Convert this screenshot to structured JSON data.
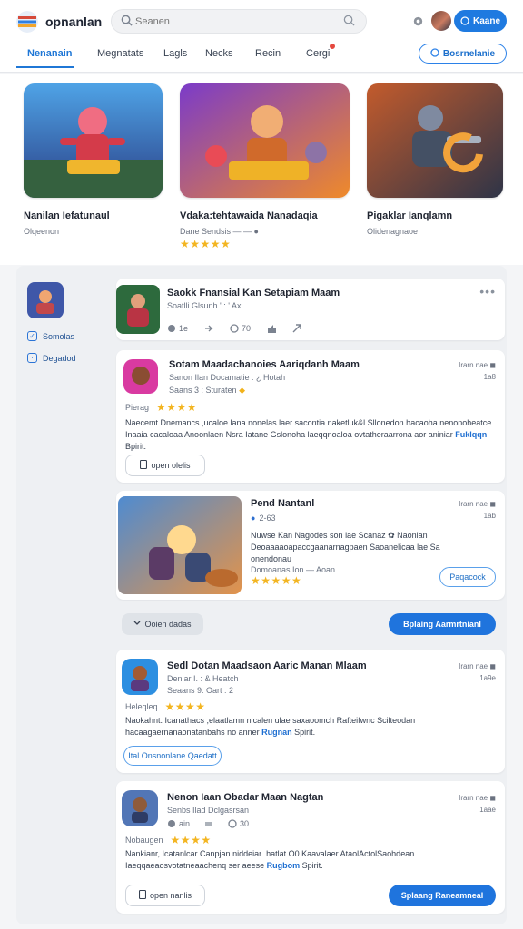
{
  "header": {
    "app_name": "opnanlan",
    "search_placeholder": "Seanen",
    "action_label": "Kaane",
    "filter_chip": "Bosrnelanie"
  },
  "tabs": [
    "Nenanain",
    "Megnatats",
    "Lagls",
    "Necks",
    "Recin",
    "Cergi"
  ],
  "featured": [
    {
      "title": "Nanilan Iefatunaul",
      "subtitle": "Olqeenon"
    },
    {
      "title": "Vdaka:tehtawaida Nanadaqia",
      "subtitle": "Dane Sendsis — — ●",
      "stars": "★★★★★"
    },
    {
      "title": "Pigaklar Ianqlamn",
      "subtitle": "Olidenagnaoe"
    }
  ],
  "sidebar": {
    "link1": "Somolas",
    "link2": "Degadod"
  },
  "post1": {
    "title": "Saokk Fnansial Kan Setapiam Maam",
    "meta": "Soatlli Glsunh ' : ' Axl",
    "c1": "1e",
    "c2": "70"
  },
  "post2": {
    "title": "Sotam Maadachanoies Aariqdanh Maam",
    "line1": "Sanon Ilan Docamatie : ¿ Hotah",
    "line2": "Saans 3 : Sturaten",
    "rating_label": "Pierag",
    "stars": "★★★★",
    "body": "Naecemt Dnemancs ,ucaloe lana nonelas laer sacontia naketluk&l Sllonedon hacaoha nenonoheatce Inaaia cacaloaa Anoonlaen Nsra Iatane Gslonoha laeqqnoaloa ovtatheraarrona aor aniniar",
    "link": "Fuklqqn",
    "link_tail": "Bpirit.",
    "button": "open olelis",
    "time1": "Irarn nae",
    "time2": "1a8"
  },
  "post3": {
    "title": "Pend Nantanl",
    "line1": "2-63",
    "body": "Nuwse Kan Nagodes son lae Scanaz ✿ Naonlan Deoaaaaoapaccgaanarnagpaen Saoanelicaa lae Sa onendonau",
    "line3": "Domoanas Ion — Aoan",
    "pill": "Paqacock",
    "time1": "Irarn nae",
    "time2": "1ab"
  },
  "actions": {
    "more": "Ooien dadas",
    "primary": "Bplaing Aarmrtnianl"
  },
  "post4": {
    "title": "Sedl Dotan Maadsaon Aaric Manan Mlaam",
    "line1": "Denlar I. : & Heatch",
    "line2": "Seaans 9. Oart : 2",
    "rating_label": "Heleqleq",
    "stars": "★★★★",
    "body": "Naokahnt. Icanathacs ,elaatlamn nicalen ulae saxaoomch Rafteifwnc Scilteodan hacaagaernanaonatanbahs no anner",
    "link": "Rugnan",
    "link_tail": "Spirit.",
    "pill": "Ital Onsnonlane Qaedatt",
    "time1": "Irarn nae",
    "time2": "1a9e"
  },
  "post5": {
    "title": "Nenon Iaan Obadar Maan Nagtan",
    "line1": "Senbs Ilad Dclgasrsan",
    "rating_label": "Nobaugen",
    "stars": "★★★★",
    "c1": "ain",
    "c2": "30",
    "body": "Nankianr, Icatanlcar Canpjan niddeiar .hatlat O0 Kaavalaer AtaolActolSaohdean Iaeqqaeaosvotatneaachenq ser aeese",
    "link": "Rugbom",
    "link_tail": "Spirit.",
    "button": "open nanlis",
    "primary": "Splaang Raneamneal",
    "time1": "Irarn nae",
    "time2": "1aae"
  }
}
